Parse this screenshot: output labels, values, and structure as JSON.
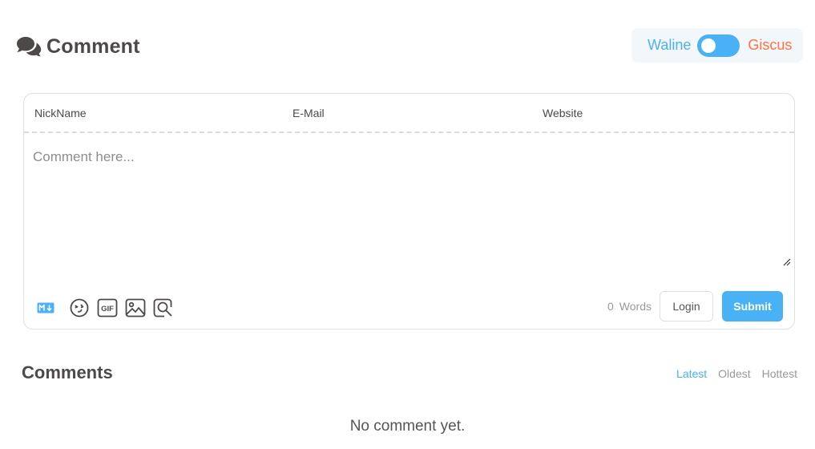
{
  "header": {
    "title": "Comment",
    "icon": "comments-icon"
  },
  "switcher": {
    "left_label": "Waline",
    "right_label": "Giscus",
    "state": "left",
    "colors": {
      "left": "#49b1f5",
      "right": "#ff7242",
      "track": "#49b1f5"
    }
  },
  "form": {
    "nick_placeholder": "NickName",
    "mail_placeholder": "E-Mail",
    "link_placeholder": "Website",
    "nick_value": "",
    "mail_value": "",
    "link_value": "",
    "editor_placeholder": "Comment here...",
    "editor_value": "",
    "toolbar_icons": [
      "markdown-icon",
      "emoji-icon",
      "gif-icon",
      "image-upload-icon",
      "preview-icon"
    ],
    "word_count": "0",
    "word_label": "Words",
    "login_label": "Login",
    "submit_label": "Submit"
  },
  "list": {
    "title": "Comments",
    "sort_tabs": [
      {
        "label": "Latest",
        "active": true
      },
      {
        "label": "Oldest",
        "active": false
      },
      {
        "label": "Hottest",
        "active": false
      }
    ],
    "empty_text": "No comment yet."
  },
  "colors": {
    "accent": "#49b1f5",
    "text": "#4c4948",
    "muted": "#999999"
  }
}
